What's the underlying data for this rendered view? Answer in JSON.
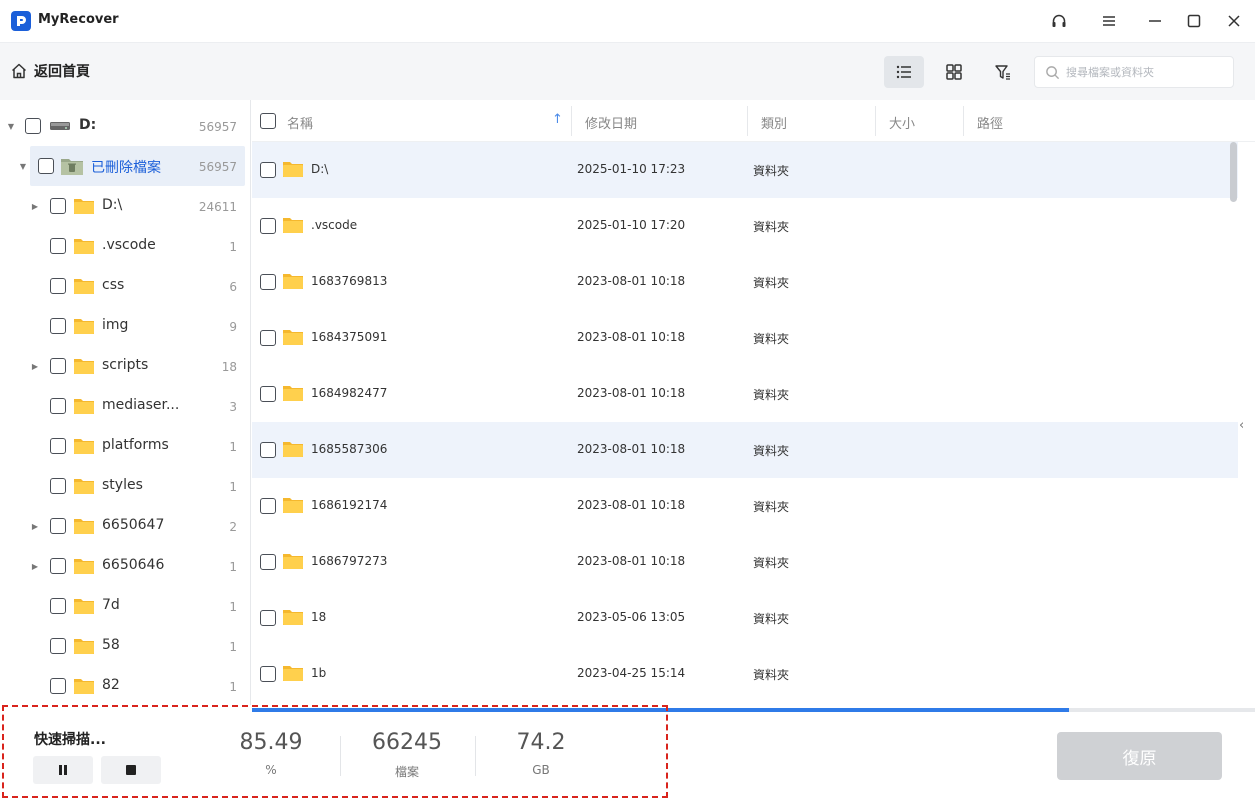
{
  "app": {
    "title": "MyRecover"
  },
  "toolbar": {
    "back_home_label": "返回首頁",
    "search_placeholder": "搜尋檔案或資料夾"
  },
  "tree": {
    "root": {
      "label": "D:",
      "count": "56957"
    },
    "deleted": {
      "label": "已刪除檔案",
      "count": "56957"
    },
    "items": [
      {
        "label": "D:\\",
        "count": "24611",
        "expandable": true
      },
      {
        "label": ".vscode",
        "count": "1",
        "expandable": false
      },
      {
        "label": "css",
        "count": "6",
        "expandable": false
      },
      {
        "label": "img",
        "count": "9",
        "expandable": false
      },
      {
        "label": "scripts",
        "count": "18",
        "expandable": true
      },
      {
        "label": "mediaser...",
        "count": "3",
        "expandable": false
      },
      {
        "label": "platforms",
        "count": "1",
        "expandable": false
      },
      {
        "label": "styles",
        "count": "1",
        "expandable": false
      },
      {
        "label": "6650647",
        "count": "2",
        "expandable": true
      },
      {
        "label": "6650646",
        "count": "1",
        "expandable": true
      },
      {
        "label": "7d",
        "count": "1",
        "expandable": false
      },
      {
        "label": "58",
        "count": "1",
        "expandable": false
      },
      {
        "label": "82",
        "count": "1",
        "expandable": false
      }
    ]
  },
  "list": {
    "columns": {
      "name": "名稱",
      "date": "修改日期",
      "type": "類別",
      "size": "大小",
      "path": "路徑"
    },
    "rows": [
      {
        "name": "D:\\",
        "date": "2025-01-10 17:23",
        "type": "資料夾"
      },
      {
        "name": ".vscode",
        "date": "2025-01-10 17:20",
        "type": "資料夾"
      },
      {
        "name": "1683769813",
        "date": "2023-08-01 10:18",
        "type": "資料夾"
      },
      {
        "name": "1684375091",
        "date": "2023-08-01 10:18",
        "type": "資料夾"
      },
      {
        "name": "1684982477",
        "date": "2023-08-01 10:18",
        "type": "資料夾"
      },
      {
        "name": "1685587306",
        "date": "2023-08-01 10:18",
        "type": "資料夾"
      },
      {
        "name": "1686192174",
        "date": "2023-08-01 10:18",
        "type": "資料夾"
      },
      {
        "name": "1686797273",
        "date": "2023-08-01 10:18",
        "type": "資料夾"
      },
      {
        "name": "18",
        "date": "2023-05-06 13:05",
        "type": "資料夾"
      },
      {
        "name": "1b",
        "date": "2023-04-25 15:14",
        "type": "資料夾"
      }
    ]
  },
  "scan": {
    "label": "快速掃描...",
    "progress_fraction": 0.8149,
    "stats": [
      {
        "value": "85.49",
        "unit": "%"
      },
      {
        "value": "66245",
        "unit": "檔案"
      },
      {
        "value": "74.2",
        "unit": "GB"
      }
    ],
    "restore_label": "復原"
  },
  "colors": {
    "accent": "#1b5fd9",
    "progress": "#2f7be8",
    "folder": "#ffc93c",
    "highlight": "#d9241c"
  }
}
